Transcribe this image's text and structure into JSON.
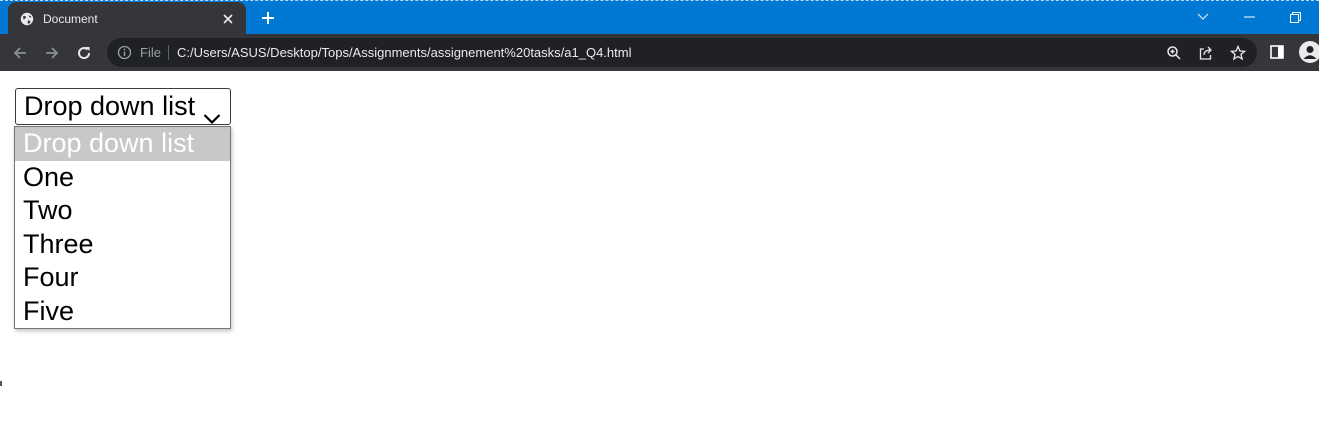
{
  "browser": {
    "tab_title": "Document",
    "omnibox": {
      "scheme_label": "File",
      "url": "C:/Users/ASUS/Desktop/Tops/Assignments/assignement%20tasks/a1_Q4.html"
    },
    "colors": {
      "titlebar": "#0078d4",
      "toolbar": "#35363a",
      "omnibox": "#202124"
    },
    "icons": [
      "globe-icon",
      "close-icon",
      "plus-icon",
      "chevron-down-icon",
      "minimize-icon",
      "restore-icon",
      "back-icon",
      "forward-icon",
      "reload-icon",
      "info-icon",
      "zoom-icon",
      "share-icon",
      "star-icon",
      "side-panel-icon",
      "profile-icon"
    ]
  },
  "page": {
    "select": {
      "selected_value": "Drop down list",
      "options": [
        "Drop down list",
        "One",
        "Two",
        "Three",
        "Four",
        "Five"
      ],
      "highlighted_index": 0
    }
  }
}
